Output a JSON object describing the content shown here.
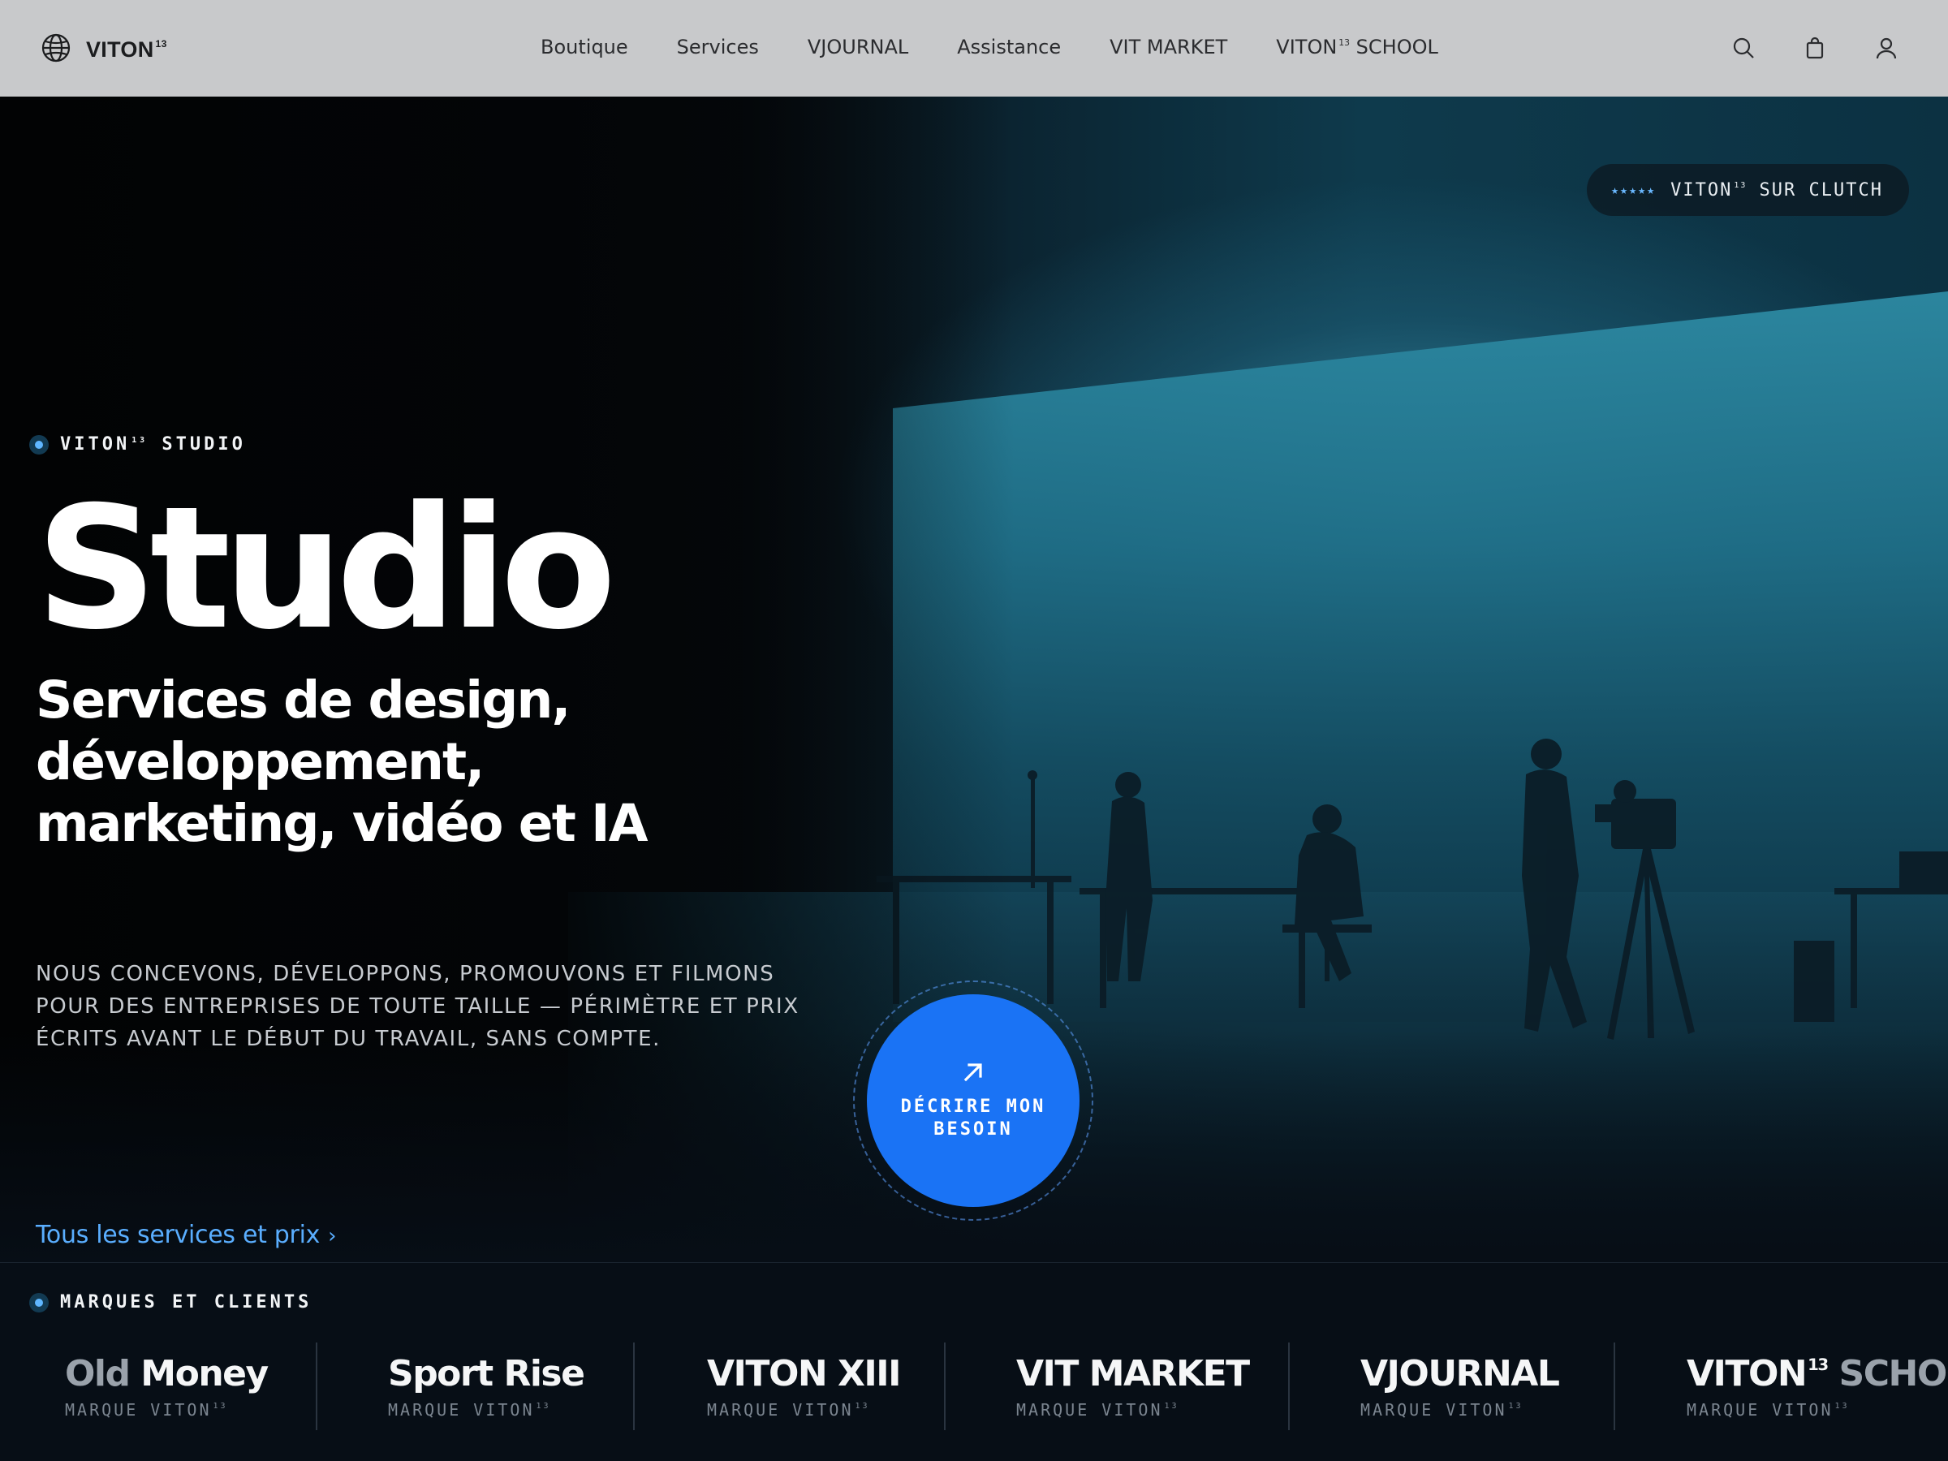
{
  "nav": {
    "brand": "VITON",
    "brand_sup": "13",
    "items": [
      "Boutique",
      "Services",
      "VJOURNAL",
      "Assistance",
      "VIT MARKET"
    ],
    "school_prefix": "VITON",
    "school_sup": "13",
    "school_suffix": " SCHOOL",
    "icons": [
      "search-icon",
      "bag-icon",
      "user-icon"
    ]
  },
  "hero": {
    "badge_stars": "★★★★★",
    "badge_brand": "VITON",
    "badge_sup": "13",
    "badge_text": " SUR CLUTCH",
    "eyebrow_brand": "VITON",
    "eyebrow_sup": "13",
    "eyebrow_text": " STUDIO",
    "title": "Studio",
    "subtitle": "Services de design, développement, marketing, vidéo et IA",
    "lead": "NOUS CONCEVONS, DÉVELOPPONS, PROMOUVONS ET FILMONS POUR DES ENTREPRISES DE TOUTE TAILLE — PÉRIMÈTRE ET PRIX ÉCRITS AVANT LE DÉBUT DU TRAVAIL, SANS COMPTE.",
    "link_label": "Tous les services et prix",
    "link_chevron": "›",
    "cta_label": "DÉCRIRE MON BESOIN"
  },
  "brands": {
    "eyebrow": "MARQUES ET CLIENTS",
    "items": [
      {
        "name_dim": "Old",
        "name": " Money",
        "sub": "MARQUE VITON",
        "sub_sup": "13"
      },
      {
        "name": "Sport Rise",
        "sub": "MARQUE VITON",
        "sub_sup": "13"
      },
      {
        "name": "VITON XIII",
        "sub": "MARQUE VITON",
        "sub_sup": "13"
      },
      {
        "name": "VIT MARKET",
        "sub": "MARQUE VITON",
        "sub_sup": "13"
      },
      {
        "name": "VJOURNAL",
        "sub": "MARQUE VITON",
        "sub_sup": "13"
      },
      {
        "name": "VITON",
        "name_sup": "13",
        "name_tail": " SCHOOL",
        "sub": "MARQUE VITON",
        "sub_sup": "13"
      }
    ]
  },
  "colors": {
    "accent": "#1a73f5",
    "link": "#5aaeff",
    "nav_bg": "#c8c9cb",
    "dot": "#5fb6ff"
  }
}
